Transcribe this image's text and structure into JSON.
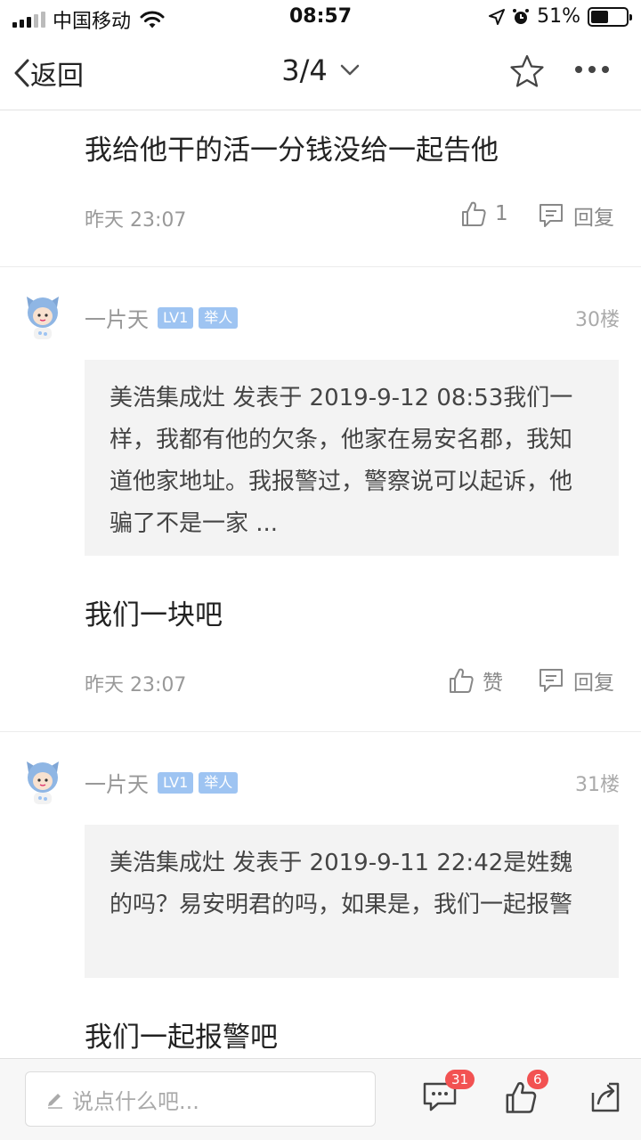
{
  "status_bar": {
    "carrier": "中国移动",
    "time": "08:57",
    "battery": "51%",
    "battery_level": 0.51
  },
  "nav": {
    "back_label": "返回",
    "page_indicator": "3/4"
  },
  "posts": [
    {
      "text": "我给他干的活一分钱没给一起告他",
      "time": "昨天 23:07",
      "like_label": "1",
      "reply_label": "回复"
    },
    {
      "user": "一片天",
      "level": "LV1",
      "role": "举人",
      "floor": "30楼",
      "quote": "美浩集成灶 发表于 2019-9-12 08:53我们一样，我都有他的欠条，他家在易安名郡，我知道他家地址。我报警过，警察说可以起诉，他骗了不是一家 ...",
      "text": "我们一块吧",
      "time": "昨天 23:07",
      "like_label": "赞",
      "reply_label": "回复"
    },
    {
      "user": "一片天",
      "level": "LV1",
      "role": "举人",
      "floor": "31楼",
      "quote": "美浩集成灶 发表于 2019-9-11 22:42是姓魏的吗？易安明君的吗，如果是，我们一起报警",
      "text": "我们一起报警吧"
    }
  ],
  "bottom_bar": {
    "input_placeholder": "说点什么吧...",
    "comment_count": "31",
    "like_count": "6"
  }
}
